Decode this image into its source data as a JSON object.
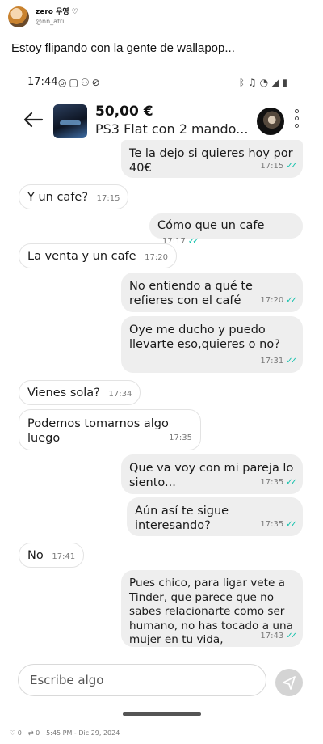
{
  "tweet": {
    "display_name": "zero 우영 ♡",
    "handle": "@nn_afri",
    "text": "Estoy flipando con la gente de wallapop...",
    "replies": "0",
    "retweets": "0",
    "timestamp": "5:45 PM - Dic 29, 2024"
  },
  "status_bar": {
    "time": "17:44",
    "left_icons": [
      "whatsapp-icon",
      "instagram-icon",
      "add-person-icon",
      "data-saver-icon"
    ],
    "right_icons": [
      "bluetooth-icon",
      "mute-icon",
      "wifi-icon",
      "signal-icon",
      "battery-icon"
    ]
  },
  "listing": {
    "price": "50,00 €",
    "title": "PS3 Flat con 2 mando..."
  },
  "messages": [
    {
      "dir": "out",
      "text": "Te la dejo si quieres hoy por 40€",
      "time": "17:15",
      "read": true
    },
    {
      "dir": "in",
      "text": "Y un cafe?",
      "time": "17:15"
    },
    {
      "dir": "out",
      "text": "Cómo que un cafe",
      "time": "17:17",
      "read": true
    },
    {
      "dir": "in",
      "text": "La venta y un cafe",
      "time": "17:20"
    },
    {
      "dir": "out",
      "text": "No entiendo a qué te refieres con el café",
      "time": "17:20",
      "read": true
    },
    {
      "dir": "out",
      "text": "Oye me ducho y puedo llevarte eso,quieres o no?",
      "time": "17:31",
      "read": true
    },
    {
      "dir": "in",
      "text": "Vienes sola?",
      "time": "17:34"
    },
    {
      "dir": "in",
      "text": "Podemos tomarnos algo luego",
      "time": "17:35"
    },
    {
      "dir": "out",
      "text": "Que va voy con mi pareja lo siento...",
      "time": "17:35",
      "read": true
    },
    {
      "dir": "out",
      "text": "Aún así te sigue interesando?",
      "time": "17:35",
      "read": true
    },
    {
      "dir": "in",
      "text": "No",
      "time": "17:41"
    },
    {
      "dir": "out",
      "text": "Pues chico, para ligar vete a Tinder, que parece que no sabes relacionarte como ser humano, no has tocado a una mujer en tu vida,",
      "time": "17:43",
      "read": true
    }
  ],
  "composer": {
    "placeholder": "Escribe algo"
  },
  "colors": {
    "outgoing_bubble": "#eeeeee",
    "incoming_bubble": "#ffffff",
    "read_ticks": "#13c1ac",
    "send_button": "#d4d4d4"
  }
}
